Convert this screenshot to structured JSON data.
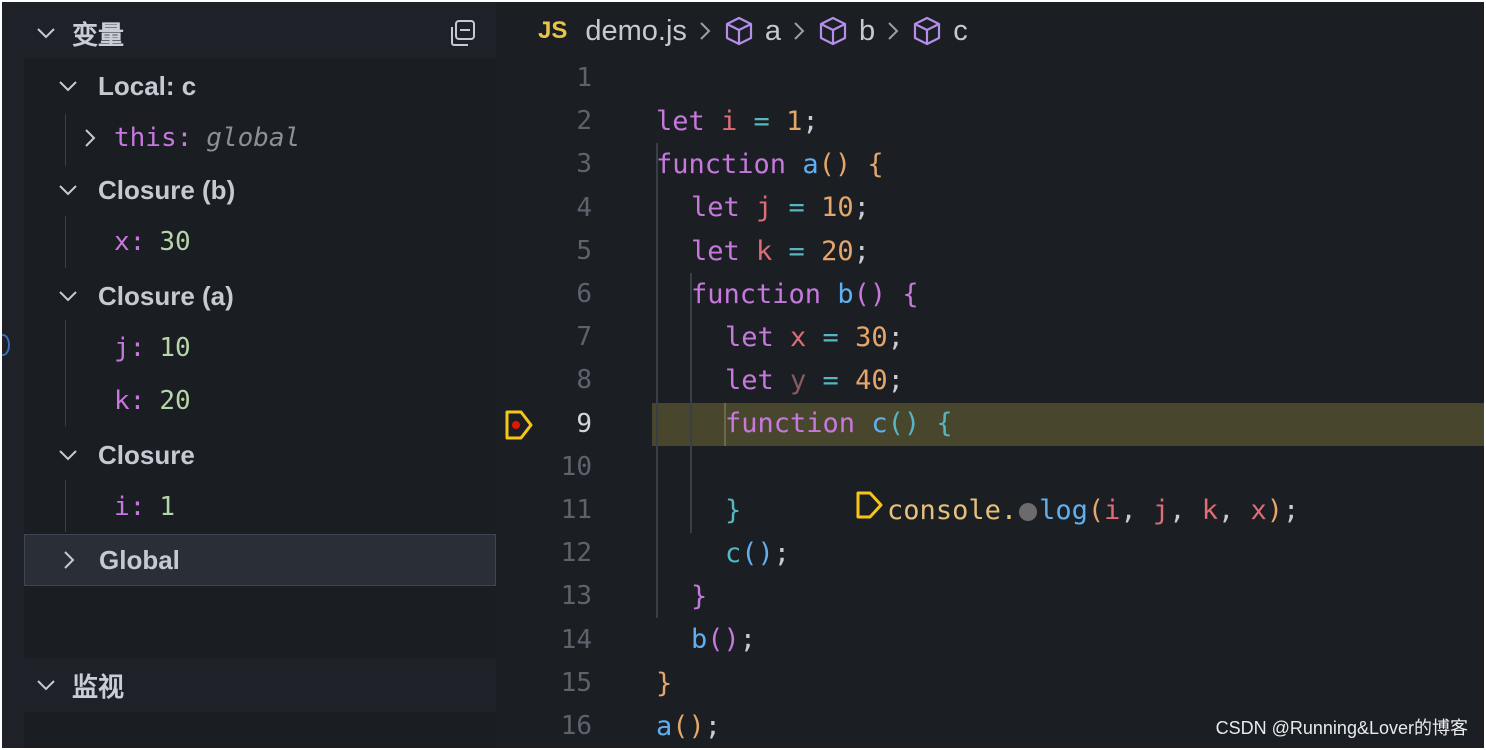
{
  "sidebar": {
    "variables_title": "变量",
    "watch_title": "监视",
    "scopes": [
      {
        "label": "Local: c",
        "vars": [
          {
            "name": "this",
            "value": "global",
            "expandable": true
          }
        ]
      },
      {
        "label": "Closure (b)",
        "vars": [
          {
            "name": "x",
            "value": "30"
          }
        ]
      },
      {
        "label": "Closure (a)",
        "vars": [
          {
            "name": "j",
            "value": "10"
          },
          {
            "name": "k",
            "value": "20"
          }
        ]
      },
      {
        "label": "Closure",
        "vars": [
          {
            "name": "i",
            "value": "1"
          }
        ]
      },
      {
        "label": "Global",
        "vars": []
      }
    ]
  },
  "editor": {
    "breadcrumb": {
      "file_icon": "JS",
      "file": "demo.js",
      "symbols": [
        "a",
        "b",
        "c"
      ]
    },
    "line_numbers": [
      "1",
      "2",
      "3",
      "4",
      "5",
      "6",
      "7",
      "8",
      "9",
      "10",
      "11",
      "12",
      "13",
      "14",
      "15",
      "16"
    ],
    "current_line": "9",
    "code": {
      "l1": [
        "let ",
        "i",
        " = ",
        "1",
        ";"
      ],
      "l2": [
        "function ",
        "a",
        "()",
        " {"
      ],
      "l3": [
        "let ",
        "j",
        " = ",
        "10",
        ";"
      ],
      "l4": [
        "let ",
        "k",
        " = ",
        "20",
        ";"
      ],
      "l5": [
        "function ",
        "b",
        "()",
        " {"
      ],
      "l6": [
        "let ",
        "x",
        " = ",
        "30",
        ";"
      ],
      "l7": [
        "let ",
        "y",
        " = ",
        "40",
        ";"
      ],
      "l8": [
        "function ",
        "c",
        "()",
        " {"
      ],
      "l9": [
        "console.",
        "log",
        "(",
        "i",
        ", ",
        "j",
        ", ",
        "k",
        ", ",
        "x",
        ")",
        ";"
      ],
      "l10": [
        "}"
      ],
      "l11": [
        "c",
        "()",
        ";"
      ],
      "l12": [
        "}"
      ],
      "l13": [
        "b",
        "()",
        ";"
      ],
      "l14": [
        "}"
      ],
      "l15": [
        "a",
        "()",
        ";"
      ]
    }
  },
  "watermark": "CSDN @Running&Lover的博客",
  "colors": {
    "background": "#1b1f24",
    "current_line": "#48472e",
    "breakpoint": "#f5c518",
    "keyword": "#c678dd",
    "function": "#61afef",
    "number": "#e5a66b",
    "variable": "#e06c75"
  }
}
